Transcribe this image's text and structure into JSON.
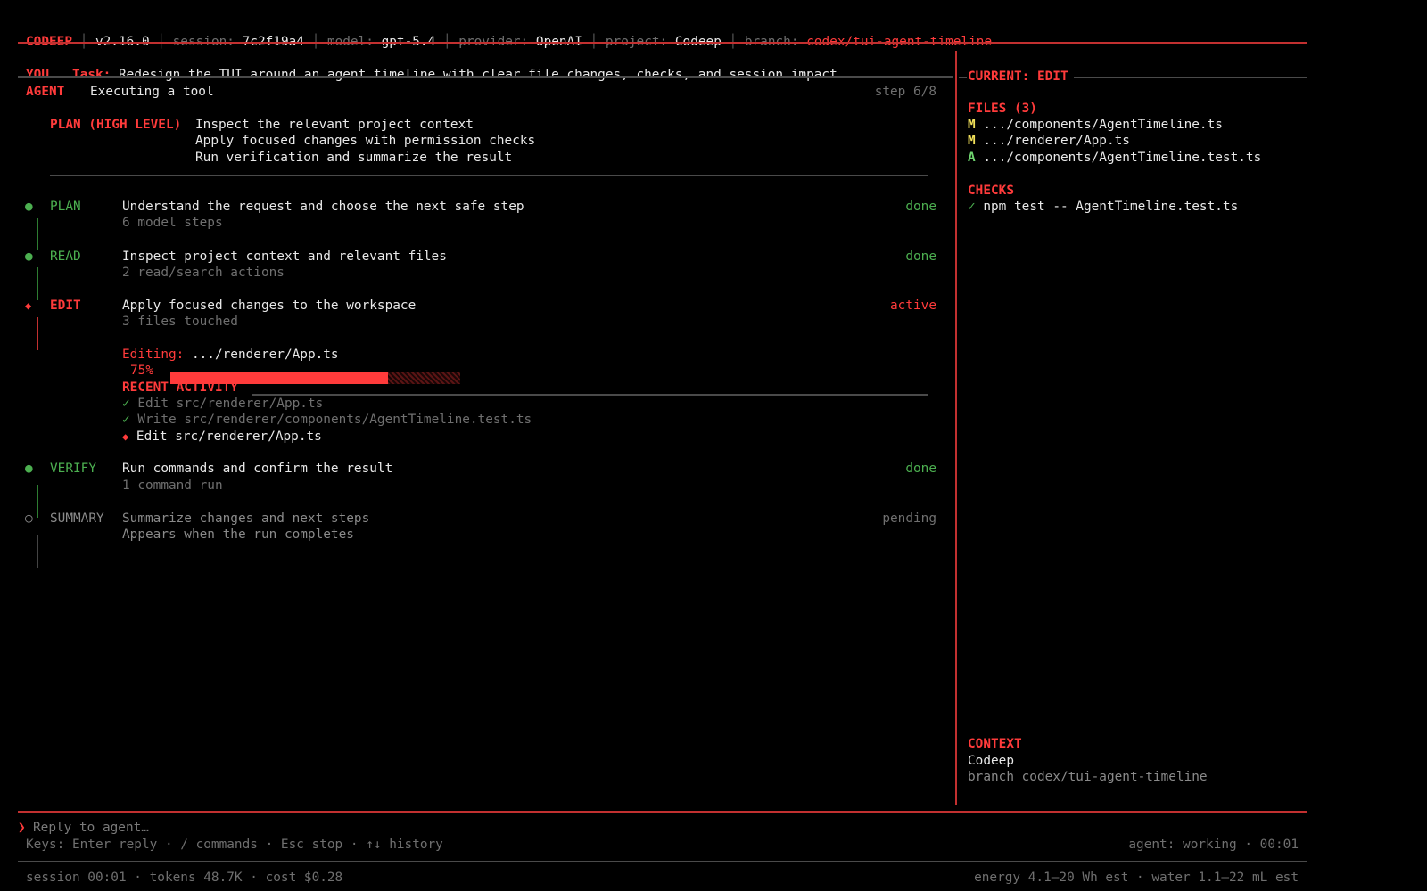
{
  "header": {
    "app": "CODEEP",
    "version": "v2.16.0",
    "session_label": "session:",
    "session": "7c2f19a4",
    "model_label": "model:",
    "model": "gpt-5.4",
    "provider_label": "provider:",
    "provider": "OpenAI",
    "project_label": "project:",
    "project": "Codeep",
    "branch_label": "branch:",
    "branch": "codex/tui-agent-timeline"
  },
  "you": {
    "label": "YOU",
    "task_label": "Task:",
    "task": "Redesign the TUI around an agent timeline with clear file changes, checks, and session impact."
  },
  "agent": {
    "label": "AGENT",
    "status": "Executing a tool",
    "step": "step 6/8",
    "plan_label": "PLAN (HIGH LEVEL)",
    "plan": [
      "Inspect the relevant project context",
      "Apply focused changes with permission checks",
      "Run verification and summarize the result"
    ]
  },
  "timeline": [
    {
      "bullet": "●",
      "name": "PLAN",
      "title": "Understand the request and choose the next safe step",
      "sub": "6 model steps",
      "status": "done"
    },
    {
      "bullet": "●",
      "name": "READ",
      "title": "Inspect project context and relevant files",
      "sub": "2 read/search actions",
      "status": "done"
    },
    {
      "bullet": "◆",
      "name": "EDIT",
      "title": "Apply focused changes to the workspace",
      "sub": "3 files touched",
      "status": "active"
    },
    {
      "bullet": "●",
      "name": "VERIFY",
      "title": "Run commands and confirm the result",
      "sub": "1 command run",
      "status": "done"
    },
    {
      "bullet": "○",
      "name": "SUMMARY",
      "title": "Summarize changes and next steps",
      "sub": "Appears when the run completes",
      "status": "pending"
    }
  ],
  "editing": {
    "label": "Editing:",
    "file": ".../renderer/App.ts",
    "progress_text": "75%",
    "progress": 0.75
  },
  "recent": {
    "label": "RECENT ACTIVITY",
    "items": [
      {
        "mark": "✓",
        "text": "Edit src/renderer/App.ts"
      },
      {
        "mark": "✓",
        "text": "Write src/renderer/components/AgentTimeline.test.ts"
      },
      {
        "mark": "◆",
        "text": "Edit src/renderer/App.ts"
      }
    ]
  },
  "side": {
    "current": "CURRENT: EDIT",
    "files_label": "FILES (3)",
    "files": [
      {
        "mark": "M",
        "path": ".../components/AgentTimeline.ts"
      },
      {
        "mark": "M",
        "path": ".../renderer/App.ts"
      },
      {
        "mark": "A",
        "path": ".../components/AgentTimeline.test.ts"
      }
    ],
    "checks_label": "CHECKS",
    "checks": [
      {
        "mark": "✓",
        "text": "npm test -- AgentTimeline.test.ts"
      }
    ],
    "context_label": "CONTEXT",
    "context_project": "Codeep",
    "context_branch": "branch codex/tui-agent-timeline"
  },
  "input": {
    "prompt": "❯",
    "placeholder": "Reply to agent…",
    "keys": "Keys: Enter reply · / commands · Esc stop · ↑↓ history",
    "agent_status": "agent: working · 00:01"
  },
  "footer": {
    "left": "session 00:01 · tokens 48.7K · cost $0.28",
    "right": "energy 4.1–20 Wh est · water 1.1–22 mL est"
  },
  "colors": {
    "accent": "#ff3b3b",
    "done": "#4caf50",
    "modified": "#f1e05a",
    "added": "#6fd46f",
    "background": "#000000"
  }
}
